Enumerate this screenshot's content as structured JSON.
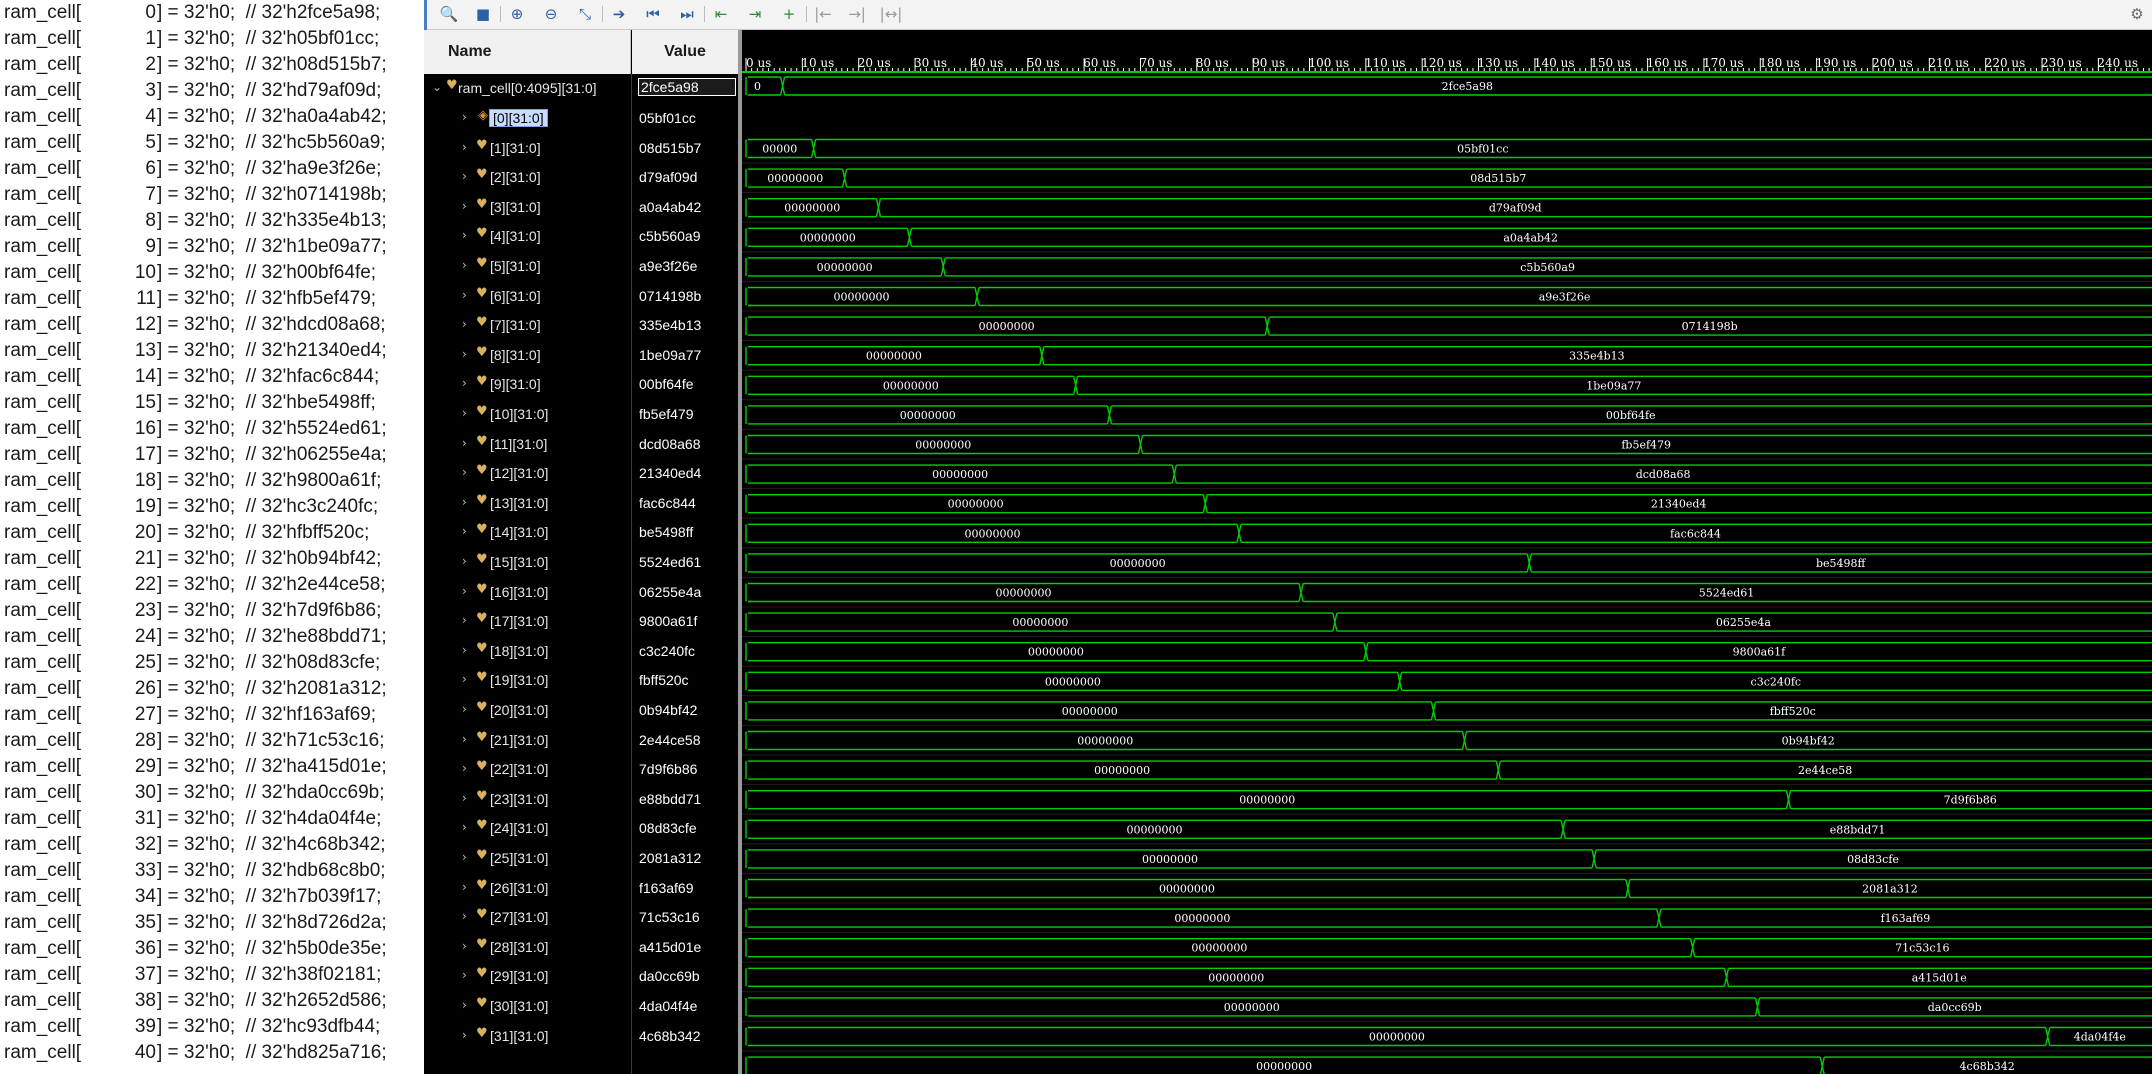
{
  "code_panel": {
    "prefix": "ram_cell[",
    "lines": [
      {
        "index": "0",
        "rest": "] = 32'h0;  // 32'h2fce5a98;"
      },
      {
        "index": "1",
        "rest": "] = 32'h0;  // 32'h05bf01cc;"
      },
      {
        "index": "2",
        "rest": "] = 32'h0;  // 32'h08d515b7;"
      },
      {
        "index": "3",
        "rest": "] = 32'h0;  // 32'hd79af09d;"
      },
      {
        "index": "4",
        "rest": "] = 32'h0;  // 32'ha0a4ab42;"
      },
      {
        "index": "5",
        "rest": "] = 32'h0;  // 32'hc5b560a9;"
      },
      {
        "index": "6",
        "rest": "] = 32'h0;  // 32'ha9e3f26e;"
      },
      {
        "index": "7",
        "rest": "] = 32'h0;  // 32'h0714198b;"
      },
      {
        "index": "8",
        "rest": "] = 32'h0;  // 32'h335e4b13;"
      },
      {
        "index": "9",
        "rest": "] = 32'h0;  // 32'h1be09a77;"
      },
      {
        "index": "10",
        "rest": "] = 32'h0;  // 32'h00bf64fe;"
      },
      {
        "index": "11",
        "rest": "] = 32'h0;  // 32'hfb5ef479;"
      },
      {
        "index": "12",
        "rest": "] = 32'h0;  // 32'hdcd08a68;"
      },
      {
        "index": "13",
        "rest": "] = 32'h0;  // 32'h21340ed4;"
      },
      {
        "index": "14",
        "rest": "] = 32'h0;  // 32'hfac6c844;"
      },
      {
        "index": "15",
        "rest": "] = 32'h0;  // 32'hbe5498ff;"
      },
      {
        "index": "16",
        "rest": "] = 32'h0;  // 32'h5524ed61;"
      },
      {
        "index": "17",
        "rest": "] = 32'h0;  // 32'h06255e4a;"
      },
      {
        "index": "18",
        "rest": "] = 32'h0;  // 32'h9800a61f;"
      },
      {
        "index": "19",
        "rest": "] = 32'h0;  // 32'hc3c240fc;"
      },
      {
        "index": "20",
        "rest": "] = 32'h0;  // 32'hfbff520c;"
      },
      {
        "index": "21",
        "rest": "] = 32'h0;  // 32'h0b94bf42;"
      },
      {
        "index": "22",
        "rest": "] = 32'h0;  // 32'h2e44ce58;"
      },
      {
        "index": "23",
        "rest": "] = 32'h0;  // 32'h7d9f6b86;"
      },
      {
        "index": "24",
        "rest": "] = 32'h0;  // 32'he88bdd71;"
      },
      {
        "index": "25",
        "rest": "] = 32'h0;  // 32'h08d83cfe;"
      },
      {
        "index": "26",
        "rest": "] = 32'h0;  // 32'h2081a312;"
      },
      {
        "index": "27",
        "rest": "] = 32'h0;  // 32'hf163af69;"
      },
      {
        "index": "28",
        "rest": "] = 32'h0;  // 32'h71c53c16;"
      },
      {
        "index": "29",
        "rest": "] = 32'h0;  // 32'ha415d01e;"
      },
      {
        "index": "30",
        "rest": "] = 32'h0;  // 32'hda0cc69b;"
      },
      {
        "index": "31",
        "rest": "] = 32'h0;  // 32'h4da04f4e;"
      },
      {
        "index": "32",
        "rest": "] = 32'h0;  // 32'h4c68b342;"
      },
      {
        "index": "33",
        "rest": "] = 32'h0;  // 32'hdb68c8b0;"
      },
      {
        "index": "34",
        "rest": "] = 32'h0;  // 32'h7b039f17;"
      },
      {
        "index": "35",
        "rest": "] = 32'h0;  // 32'h8d726d2a;"
      },
      {
        "index": "36",
        "rest": "] = 32'h0;  // 32'h5b0de35e;"
      },
      {
        "index": "37",
        "rest": "] = 32'h0;  // 32'h38f02181;"
      },
      {
        "index": "38",
        "rest": "] = 32'h0;  // 32'h2652d586;"
      },
      {
        "index": "39",
        "rest": "] = 32'h0;  // 32'hc93dfb44;"
      },
      {
        "index": "40",
        "rest": "] = 32'h0;  // 32'hd825a716;"
      }
    ]
  },
  "toolbar": {
    "icons": [
      {
        "name": "search-icon",
        "glyph": "🔍",
        "color": "#2f5fa8"
      },
      {
        "name": "save-icon",
        "glyph": "■",
        "color": "#2f5fa8"
      },
      {
        "name": "zoom-in-icon",
        "glyph": "⊕",
        "color": "#2f5fa8"
      },
      {
        "name": "zoom-out-icon",
        "glyph": "⊖",
        "color": "#2f5fa8"
      },
      {
        "name": "zoom-fit-icon",
        "glyph": "⤡",
        "color": "#2f5fa8"
      },
      {
        "name": "goto-cursor-icon",
        "glyph": "➔",
        "color": "#2f5fa8"
      },
      {
        "name": "goto-start-icon",
        "glyph": "⏮",
        "color": "#2f5fa8"
      },
      {
        "name": "goto-end-icon",
        "glyph": "⏭",
        "color": "#2f5fa8"
      },
      {
        "name": "previous-transition-icon",
        "glyph": "⇤",
        "color": "#2f8a3a"
      },
      {
        "name": "next-transition-icon",
        "glyph": "⇥",
        "color": "#2f8a3a"
      },
      {
        "name": "add-marker-icon",
        "glyph": "+",
        "color": "#2f8a3a"
      },
      {
        "name": "previous-marker-icon",
        "glyph": "|←",
        "color": "#9a9a9a"
      },
      {
        "name": "next-marker-icon",
        "glyph": "→|",
        "color": "#9a9a9a"
      },
      {
        "name": "swap-cursors-icon",
        "glyph": "|↔|",
        "color": "#9a9a9a"
      }
    ],
    "settings_icon": {
      "name": "gear-icon",
      "glyph": "⚙",
      "color": "#6a6a6a"
    }
  },
  "headers": {
    "name": "Name",
    "value": "Value"
  },
  "root_signal": {
    "name": "ram_cell[0:4095][31:0]",
    "value": "2fce5a98",
    "icon": "bus-signal-icon"
  },
  "signals": [
    {
      "name": "[0][31:0]",
      "value": "05bf01cc",
      "selected": true
    },
    {
      "name": "[1][31:0]",
      "value": "08d515b7"
    },
    {
      "name": "[2][31:0]",
      "value": "d79af09d"
    },
    {
      "name": "[3][31:0]",
      "value": "a0a4ab42"
    },
    {
      "name": "[4][31:0]",
      "value": "c5b560a9"
    },
    {
      "name": "[5][31:0]",
      "value": "a9e3f26e"
    },
    {
      "name": "[6][31:0]",
      "value": "0714198b"
    },
    {
      "name": "[7][31:0]",
      "value": "335e4b13"
    },
    {
      "name": "[8][31:0]",
      "value": "1be09a77"
    },
    {
      "name": "[9][31:0]",
      "value": "00bf64fe"
    },
    {
      "name": "[10][31:0]",
      "value": "fb5ef479"
    },
    {
      "name": "[11][31:0]",
      "value": "dcd08a68"
    },
    {
      "name": "[12][31:0]",
      "value": "21340ed4"
    },
    {
      "name": "[13][31:0]",
      "value": "fac6c844"
    },
    {
      "name": "[14][31:0]",
      "value": "be5498ff"
    },
    {
      "name": "[15][31:0]",
      "value": "5524ed61"
    },
    {
      "name": "[16][31:0]",
      "value": "06255e4a"
    },
    {
      "name": "[17][31:0]",
      "value": "9800a61f"
    },
    {
      "name": "[18][31:0]",
      "value": "c3c240fc"
    },
    {
      "name": "[19][31:0]",
      "value": "fbff520c"
    },
    {
      "name": "[20][31:0]",
      "value": "0b94bf42"
    },
    {
      "name": "[21][31:0]",
      "value": "2e44ce58"
    },
    {
      "name": "[22][31:0]",
      "value": "7d9f6b86"
    },
    {
      "name": "[23][31:0]",
      "value": "e88bdd71"
    },
    {
      "name": "[24][31:0]",
      "value": "08d83cfe"
    },
    {
      "name": "[25][31:0]",
      "value": "2081a312"
    },
    {
      "name": "[26][31:0]",
      "value": "f163af69"
    },
    {
      "name": "[27][31:0]",
      "value": "71c53c16"
    },
    {
      "name": "[28][31:0]",
      "value": "a415d01e"
    },
    {
      "name": "[29][31:0]",
      "value": "da0cc69b"
    },
    {
      "name": "[30][31:0]",
      "value": "4da04f4e"
    },
    {
      "name": "[31][31:0]",
      "value": "4c68b342"
    }
  ],
  "colors": {
    "wave": "#00d000",
    "wave_text": "#ffffff",
    "ruler_text": "#ffffff",
    "background": "#000000"
  },
  "chart_data": {
    "type": "waveform",
    "time_unit": "us",
    "xlim": [
      0,
      250
    ],
    "ruler": {
      "major_step": 10,
      "labels": [
        "0 us",
        "10 us",
        "20 us",
        "30 us",
        "40 us",
        "50 us",
        "60 us",
        "70 us",
        "80 us",
        "90 us",
        "100 us",
        "110 us",
        "120 us",
        "130 us",
        "140 us",
        "150 us",
        "160 us",
        "170 us",
        "180 us",
        "190 us",
        "200 us",
        "210 us",
        "220 us",
        "230 us",
        "240 us"
      ]
    },
    "traces": [
      {
        "signal": "ram_cell[0:4095][31:0]",
        "segments": [
          {
            "start": 0,
            "value": "0"
          },
          {
            "start": 6.5,
            "value": "2fce5a98"
          }
        ]
      },
      {
        "signal": "[0][31:0]",
        "segments": [
          {
            "start": 0,
            "value": "00000"
          },
          {
            "start": 12,
            "value": "05bf01cc"
          }
        ]
      },
      {
        "signal": "[1][31:0]",
        "segments": [
          {
            "start": 0,
            "value": "00000000"
          },
          {
            "start": 17.5,
            "value": "08d515b7"
          }
        ]
      },
      {
        "signal": "[2][31:0]",
        "segments": [
          {
            "start": 0,
            "value": "00000000"
          },
          {
            "start": 23.5,
            "value": "d79af09d"
          }
        ]
      },
      {
        "signal": "[3][31:0]",
        "segments": [
          {
            "start": 0,
            "value": "00000000"
          },
          {
            "start": 29,
            "value": "a0a4ab42"
          }
        ]
      },
      {
        "signal": "[4][31:0]",
        "segments": [
          {
            "start": 0,
            "value": "00000000"
          },
          {
            "start": 35,
            "value": "c5b560a9"
          }
        ]
      },
      {
        "signal": "[5][31:0]",
        "segments": [
          {
            "start": 0,
            "value": "00000000"
          },
          {
            "start": 41,
            "value": "a9e3f26e"
          }
        ]
      },
      {
        "signal": "[6][31:0]",
        "segments": [
          {
            "start": 0,
            "value": "00000000"
          },
          {
            "start": 92.5,
            "value": "0714198b"
          }
        ]
      },
      {
        "signal": "[7][31:0]",
        "segments": [
          {
            "start": 0,
            "value": "00000000"
          },
          {
            "start": 52.5,
            "value": "335e4b13"
          }
        ]
      },
      {
        "signal": "[8][31:0]",
        "segments": [
          {
            "start": 0,
            "value": "00000000"
          },
          {
            "start": 58.5,
            "value": "1be09a77"
          }
        ]
      },
      {
        "signal": "[9][31:0]",
        "segments": [
          {
            "start": 0,
            "value": "00000000"
          },
          {
            "start": 64.5,
            "value": "00bf64fe"
          }
        ]
      },
      {
        "signal": "[10][31:0]",
        "segments": [
          {
            "start": 0,
            "value": "00000000"
          },
          {
            "start": 70,
            "value": "fb5ef479"
          }
        ]
      },
      {
        "signal": "[11][31:0]",
        "segments": [
          {
            "start": 0,
            "value": "00000000"
          },
          {
            "start": 76,
            "value": "dcd08a68"
          }
        ]
      },
      {
        "signal": "[12][31:0]",
        "segments": [
          {
            "start": 0,
            "value": "00000000"
          },
          {
            "start": 81.5,
            "value": "21340ed4"
          }
        ]
      },
      {
        "signal": "[13][31:0]",
        "segments": [
          {
            "start": 0,
            "value": "00000000"
          },
          {
            "start": 87.5,
            "value": "fac6c844"
          }
        ]
      },
      {
        "signal": "[14][31:0]",
        "segments": [
          {
            "start": 0,
            "value": "00000000"
          },
          {
            "start": 139,
            "value": "be5498ff"
          }
        ]
      },
      {
        "signal": "[15][31:0]",
        "segments": [
          {
            "start": 0,
            "value": "00000000"
          },
          {
            "start": 98.5,
            "value": "5524ed61"
          }
        ]
      },
      {
        "signal": "[16][31:0]",
        "segments": [
          {
            "start": 0,
            "value": "00000000"
          },
          {
            "start": 104.5,
            "value": "06255e4a"
          }
        ]
      },
      {
        "signal": "[17][31:0]",
        "segments": [
          {
            "start": 0,
            "value": "00000000"
          },
          {
            "start": 110,
            "value": "9800a61f"
          }
        ]
      },
      {
        "signal": "[18][31:0]",
        "segments": [
          {
            "start": 0,
            "value": "00000000"
          },
          {
            "start": 116,
            "value": "c3c240fc"
          }
        ]
      },
      {
        "signal": "[19][31:0]",
        "segments": [
          {
            "start": 0,
            "value": "00000000"
          },
          {
            "start": 122,
            "value": "fbff520c"
          }
        ]
      },
      {
        "signal": "[20][31:0]",
        "segments": [
          {
            "start": 0,
            "value": "00000000"
          },
          {
            "start": 127.5,
            "value": "0b94bf42"
          }
        ]
      },
      {
        "signal": "[21][31:0]",
        "segments": [
          {
            "start": 0,
            "value": "00000000"
          },
          {
            "start": 133.5,
            "value": "2e44ce58"
          }
        ]
      },
      {
        "signal": "[22][31:0]",
        "segments": [
          {
            "start": 0,
            "value": "00000000"
          },
          {
            "start": 185,
            "value": "7d9f6b86"
          }
        ]
      },
      {
        "signal": "[23][31:0]",
        "segments": [
          {
            "start": 0,
            "value": "00000000"
          },
          {
            "start": 145,
            "value": "e88bdd71"
          }
        ]
      },
      {
        "signal": "[24][31:0]",
        "segments": [
          {
            "start": 0,
            "value": "00000000"
          },
          {
            "start": 150.5,
            "value": "08d83cfe"
          }
        ]
      },
      {
        "signal": "[25][31:0]",
        "segments": [
          {
            "start": 0,
            "value": "00000000"
          },
          {
            "start": 156.5,
            "value": "2081a312"
          }
        ]
      },
      {
        "signal": "[26][31:0]",
        "segments": [
          {
            "start": 0,
            "value": "00000000"
          },
          {
            "start": 162,
            "value": "f163af69"
          }
        ]
      },
      {
        "signal": "[27][31:0]",
        "segments": [
          {
            "start": 0,
            "value": "00000000"
          },
          {
            "start": 168,
            "value": "71c53c16"
          }
        ]
      },
      {
        "signal": "[28][31:0]",
        "segments": [
          {
            "start": 0,
            "value": "00000000"
          },
          {
            "start": 174,
            "value": "a415d01e"
          }
        ]
      },
      {
        "signal": "[29][31:0]",
        "segments": [
          {
            "start": 0,
            "value": "00000000"
          },
          {
            "start": 179.5,
            "value": "da0cc69b"
          }
        ]
      },
      {
        "signal": "[30][31:0]",
        "segments": [
          {
            "start": 0,
            "value": "00000000"
          },
          {
            "start": 231,
            "value": "4da04f4e"
          }
        ]
      },
      {
        "signal": "[31][31:0]",
        "segments": [
          {
            "start": 0,
            "value": "00000000"
          },
          {
            "start": 191,
            "value": "4c68b342"
          }
        ]
      }
    ]
  }
}
